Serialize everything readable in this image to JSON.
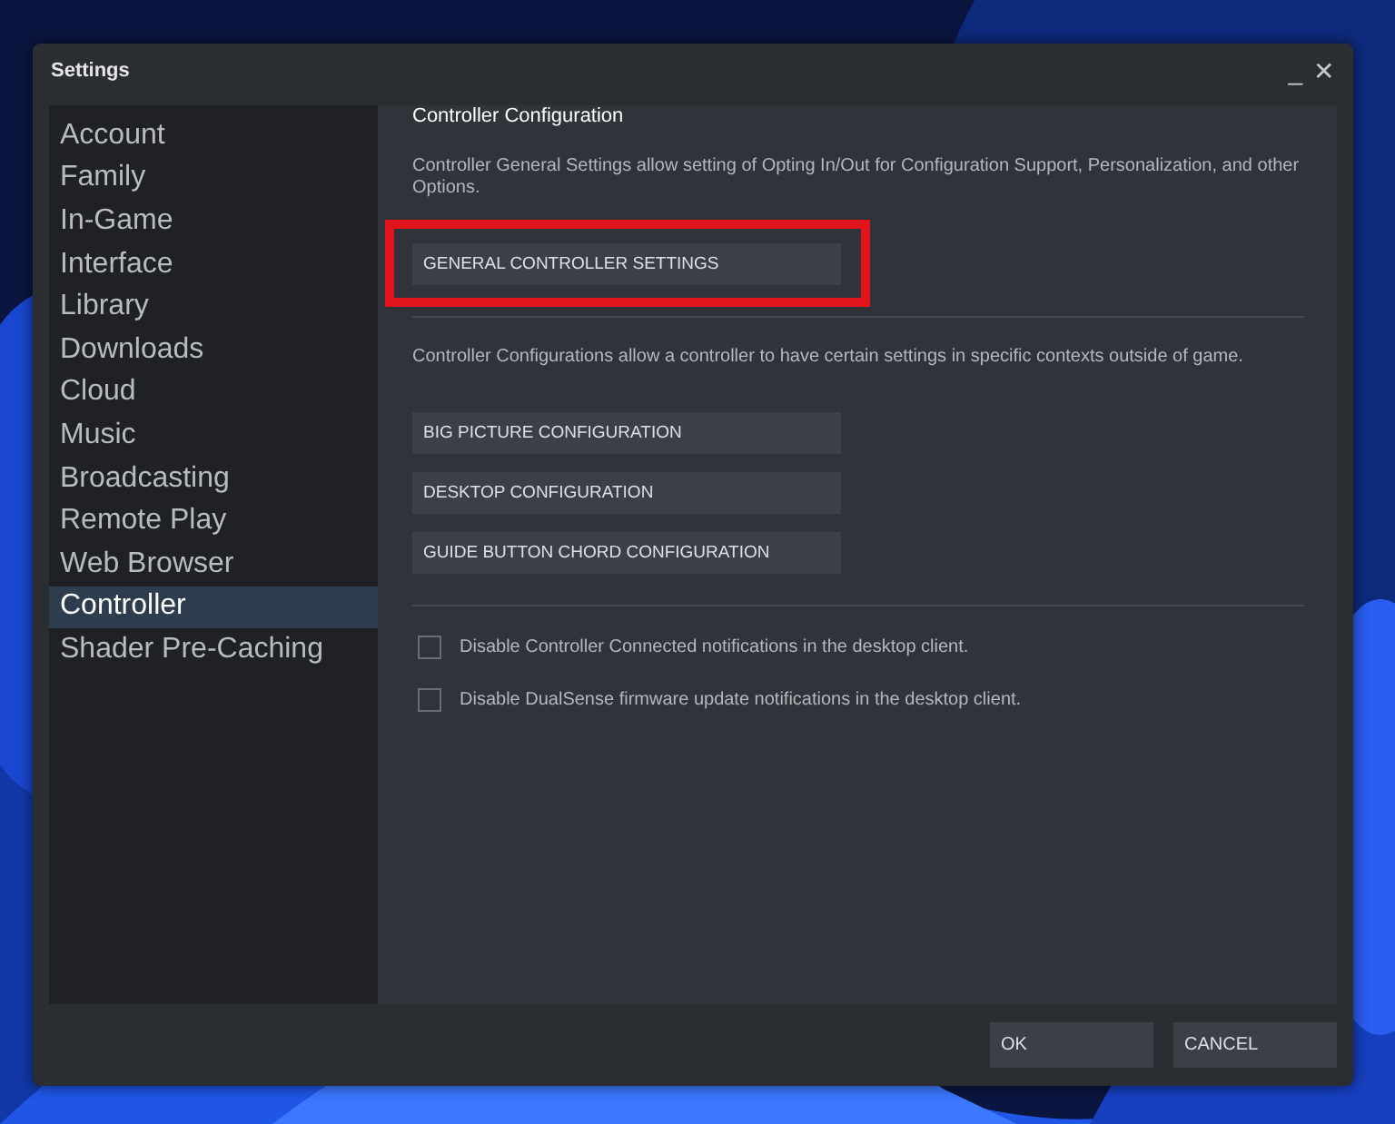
{
  "window": {
    "title": "Settings",
    "controls": [
      "_",
      "✕"
    ]
  },
  "sidebar": {
    "items": [
      {
        "label": "Account",
        "selected": false
      },
      {
        "label": "Family",
        "selected": false
      },
      {
        "label": "In-Game",
        "selected": false
      },
      {
        "label": "Interface",
        "selected": false
      },
      {
        "label": "Library",
        "selected": false
      },
      {
        "label": "Downloads",
        "selected": false
      },
      {
        "label": "Cloud",
        "selected": false
      },
      {
        "label": "Music",
        "selected": false
      },
      {
        "label": "Broadcasting",
        "selected": false
      },
      {
        "label": "Remote Play",
        "selected": false
      },
      {
        "label": "Web Browser",
        "selected": false
      },
      {
        "label": "Controller",
        "selected": true
      },
      {
        "label": "Shader Pre-Caching",
        "selected": false
      }
    ]
  },
  "content": {
    "heading": "Controller Configuration",
    "sections": [
      {
        "description": "Controller General Settings allow setting of Opting In/Out for Configuration Support, Personalization, and other Options.",
        "buttons": [
          {
            "label": "GENERAL CONTROLLER SETTINGS",
            "highlighted": true
          }
        ]
      },
      {
        "description": "Controller Configurations allow a controller to have certain settings in specific contexts outside of game.",
        "buttons": [
          {
            "label": "BIG PICTURE CONFIGURATION",
            "highlighted": false
          },
          {
            "label": "DESKTOP CONFIGURATION",
            "highlighted": false
          },
          {
            "label": "GUIDE BUTTON CHORD CONFIGURATION",
            "highlighted": false
          }
        ]
      }
    ],
    "checkboxes": [
      {
        "label": "Disable Controller Connected notifications in the desktop client.",
        "checked": false
      },
      {
        "label": "Disable DualSense firmware update notifications in the desktop client.",
        "checked": false
      }
    ]
  },
  "footer": {
    "buttons": [
      "OK",
      "CANCEL"
    ]
  }
}
